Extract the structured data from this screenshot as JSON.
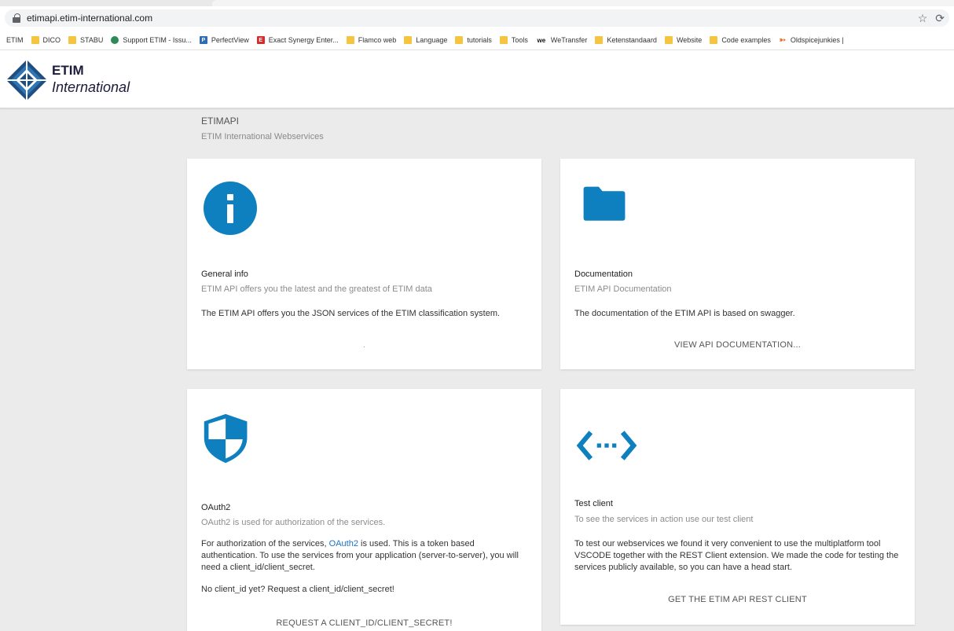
{
  "browser": {
    "url": "etimapi.etim-international.com",
    "bookmarks": [
      {
        "label": "ETIM",
        "icon": "none"
      },
      {
        "label": "DICO",
        "icon": "folder-icon"
      },
      {
        "label": "STABU",
        "icon": "folder-icon"
      },
      {
        "label": "Support ETIM - Issu...",
        "icon": "globe-icon"
      },
      {
        "label": "PerfectView",
        "icon": "p-icon",
        "glyph": "P"
      },
      {
        "label": "Exact Synergy Enter...",
        "icon": "e-icon",
        "glyph": "E"
      },
      {
        "label": "Flamco web",
        "icon": "folder-icon"
      },
      {
        "label": "Language",
        "icon": "folder-icon"
      },
      {
        "label": "tutorials",
        "icon": "folder-icon"
      },
      {
        "label": "Tools",
        "icon": "folder-icon"
      },
      {
        "label": "WeTransfer",
        "icon": "we-icon",
        "glyph": "we"
      },
      {
        "label": "Ketenstandaard",
        "icon": "folder-icon"
      },
      {
        "label": "Website",
        "icon": "folder-icon"
      },
      {
        "label": "Code examples",
        "icon": "folder-icon"
      },
      {
        "label": "Oldspicejunkies |",
        "icon": "swirl-icon",
        "glyph": "➳"
      }
    ]
  },
  "header": {
    "brand_title": "ETIM",
    "brand_subtitle": "International"
  },
  "page": {
    "title": "ETIMAPI",
    "subtitle": "ETIM International Webservices"
  },
  "cards": {
    "general": {
      "title": "General info",
      "subtitle": "ETIM API offers you the latest and the greatest of ETIM data",
      "body": "The ETIM API offers you the JSON services of the ETIM classification system.",
      "action": "."
    },
    "documentation": {
      "title": "Documentation",
      "subtitle": "ETIM API Documentation",
      "body": "The documentation of the ETIM API is based on swagger.",
      "action": "VIEW API DOCUMENTATION..."
    },
    "oauth": {
      "title": "OAuth2",
      "subtitle": "OAuth2 is used for authorization of the services.",
      "body_pre": "For authorization of the services, ",
      "body_link": "OAuth2",
      "body_post": " is used. This is a token based authentication. To use the services from your application (server-to-server), you will need a client_id/client_secret.",
      "body2": "No client_id yet? Request a client_id/client_secret!",
      "action": "REQUEST A CLIENT_ID/CLIENT_SECRET!"
    },
    "testclient": {
      "title": "Test client",
      "subtitle": "To see the services in action use our test client",
      "body": "To test our webservices we found it very convenient to use the multiplatform tool VSCODE together with the REST Client extension. We made the code for testing the services publicly available, so you can have a head start.",
      "action": "GET THE ETIM API REST CLIENT"
    }
  },
  "colors": {
    "accent": "#0e7fbf",
    "background": "#ebebeb"
  }
}
